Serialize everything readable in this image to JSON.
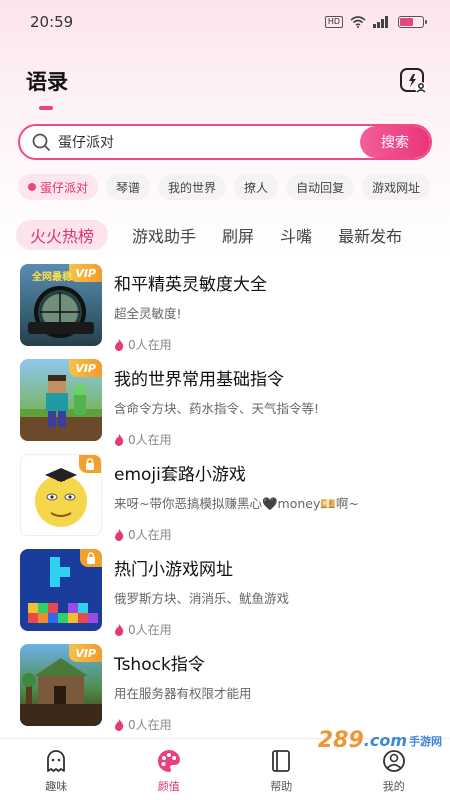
{
  "status": {
    "time": "20:59",
    "hd_label": "HD"
  },
  "header": {
    "title": "语录",
    "icon": "headset-user-icon"
  },
  "search": {
    "value": "蛋仔派对",
    "button_label": "搜索"
  },
  "chips": [
    {
      "label": "蛋仔派对",
      "active": true
    },
    {
      "label": "琴谱",
      "active": false
    },
    {
      "label": "我的世界",
      "active": false
    },
    {
      "label": "撩人",
      "active": false
    },
    {
      "label": "自动回复",
      "active": false
    },
    {
      "label": "游戏网址",
      "active": false
    }
  ],
  "tabs": [
    {
      "label": "火火热榜",
      "active": true
    },
    {
      "label": "游戏助手",
      "active": false
    },
    {
      "label": "刷屏",
      "active": false
    },
    {
      "label": "斗嘴",
      "active": false
    },
    {
      "label": "最新发布",
      "active": false
    }
  ],
  "items": [
    {
      "title": "和平精英灵敏度大全",
      "desc": "超全灵敏度!",
      "users": "0人在用",
      "badge": "VIP",
      "badge_type": "vip",
      "thumb_text": "全网最稳"
    },
    {
      "title": "我的世界常用基础指令",
      "desc": "含命令方块、药水指令、天气指令等!",
      "users": "0人在用",
      "badge": "VIP",
      "badge_type": "vip",
      "thumb_text": ""
    },
    {
      "title": "emoji套路小游戏",
      "desc": "来呀~带你恶搞模拟赚黑心🖤money💴啊~",
      "users": "0人在用",
      "badge": "",
      "badge_type": "lock",
      "thumb_text": ""
    },
    {
      "title": "热门小游戏网址",
      "desc": "俄罗斯方块、消消乐、鱿鱼游戏",
      "users": "0人在用",
      "badge": "",
      "badge_type": "lock",
      "thumb_text": ""
    },
    {
      "title": "Tshock指令",
      "desc": "用在服务器有权限才能用",
      "users": "0人在用",
      "badge": "VIP",
      "badge_type": "vip",
      "thumb_text": ""
    }
  ],
  "bottom_nav": [
    {
      "label": "趣味",
      "icon": "ghost-icon",
      "active": false
    },
    {
      "label": "颜值",
      "icon": "palette-icon",
      "active": true
    },
    {
      "label": "帮助",
      "icon": "book-icon",
      "active": false
    },
    {
      "label": "我的",
      "icon": "profile-icon",
      "active": false
    }
  ],
  "watermark": {
    "brand": "289",
    "suffix": ".com",
    "sub": "手游网"
  },
  "colors": {
    "accent": "#e9357a",
    "chip_active_bg": "#fde6ef",
    "vip_badge": "#f39b2a"
  }
}
